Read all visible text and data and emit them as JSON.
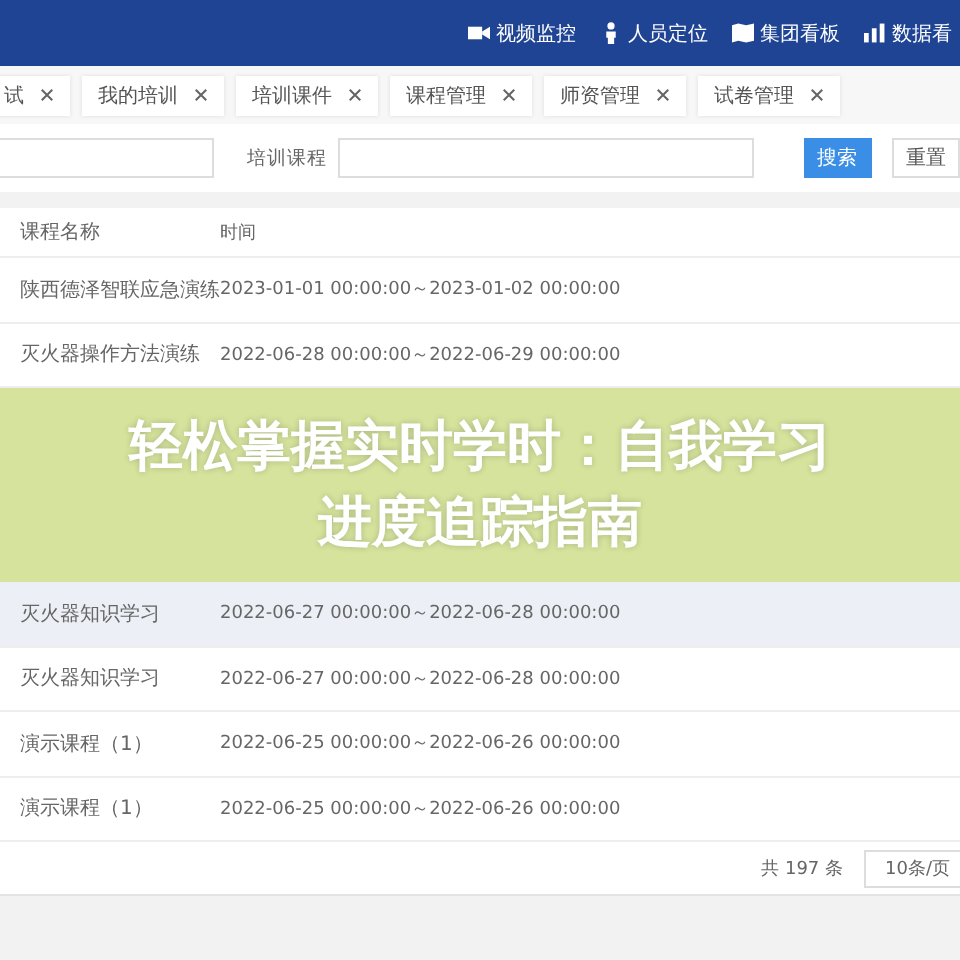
{
  "header": {
    "nav": [
      {
        "label": "视频监控"
      },
      {
        "label": "人员定位"
      },
      {
        "label": "集团看板"
      },
      {
        "label": "数据看"
      }
    ]
  },
  "tabs": [
    {
      "label": "试",
      "selected": false
    },
    {
      "label": "我的培训",
      "selected": false
    },
    {
      "label": "培训课件",
      "selected": false
    },
    {
      "label": "课程管理",
      "selected": false
    },
    {
      "label": "师资管理",
      "selected": false
    },
    {
      "label": "试卷管理",
      "selected": false
    }
  ],
  "search": {
    "field_label": "培训课程",
    "buttons": [
      "搜索",
      "重置"
    ]
  },
  "table": {
    "columns": [
      "课程名称",
      "时间"
    ],
    "rows": [
      {
        "name": "陕西德泽智联应急演练",
        "time": "2023-01-01 00:00:00～2023-01-02 00:00:00",
        "highlighted": false
      },
      {
        "name": "灭火器操作方法演练",
        "time": "2022-06-28 00:00:00～2022-06-29 00:00:00",
        "highlighted": false
      },
      {
        "name": "灭火器知识学习",
        "time": "2022-06-27 00:00:00～2022-06-28 00:00:00",
        "highlighted": true
      },
      {
        "name": "灭火器知识学习",
        "time": "2022-06-27 00:00:00～2022-06-28 00:00:00",
        "highlighted": false
      },
      {
        "name": "演示课程（1）",
        "time": "2022-06-25 00:00:00～2022-06-26 00:00:00",
        "highlighted": false
      },
      {
        "name": "演示课程（1）",
        "time": "2022-06-25 00:00:00～2022-06-26 00:00:00",
        "highlighted": false
      }
    ]
  },
  "pager": {
    "total": "共 197 条",
    "page_size": "10条/页"
  },
  "banner": {
    "lines": [
      "轻松掌握实时学时：自我学习",
      "进度追踪指南"
    ]
  }
}
